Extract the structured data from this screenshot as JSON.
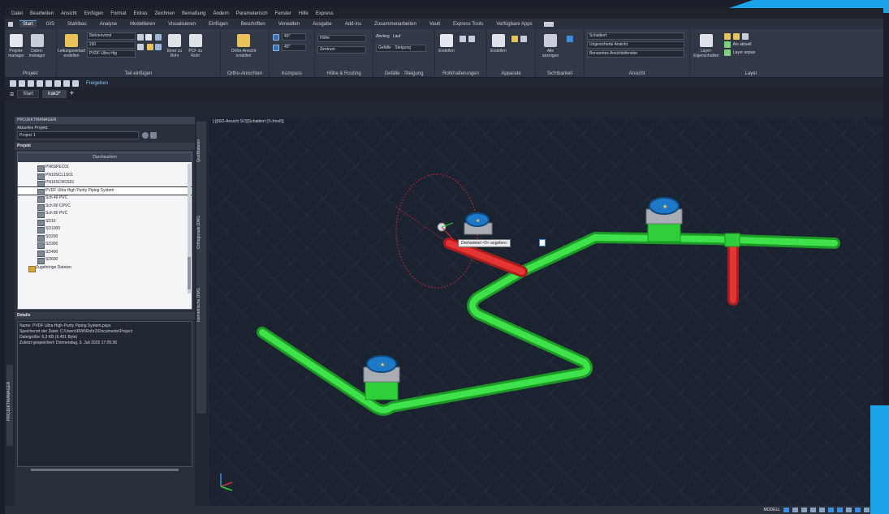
{
  "menu": [
    "Datei",
    "Bearbeiten",
    "Ansicht",
    "Einfügen",
    "Format",
    "Extras",
    "Zeichnen",
    "Bemaßung",
    "Ändern",
    "Parameterisch",
    "Fenster",
    "Hilfe",
    "Express"
  ],
  "ribbon_tabs": [
    {
      "label": "Start",
      "active": true
    },
    {
      "label": "GIS",
      "active": false
    },
    {
      "label": "Stahlbau",
      "active": false
    },
    {
      "label": "Analyse",
      "active": false
    },
    {
      "label": "Modellieren",
      "active": false
    },
    {
      "label": "Visualisieren",
      "active": false
    },
    {
      "label": "Einfügen",
      "active": false
    },
    {
      "label": "Beschriften",
      "active": false
    },
    {
      "label": "Verwalten",
      "active": false
    },
    {
      "label": "Ausgabe",
      "active": false
    },
    {
      "label": "Add-ins",
      "active": false
    },
    {
      "label": "Zusammenarbeiten",
      "active": false
    },
    {
      "label": "Vault",
      "active": false
    },
    {
      "label": "Express Tools",
      "active": false
    },
    {
      "label": "Verfügbare Apps",
      "active": false
    }
  ],
  "ribbon": {
    "projekt": {
      "title": "Projekt",
      "btn1": "Projekt-manager",
      "btn2": "Daten-manager"
    },
    "teil": {
      "title": "Teil einfügen",
      "btn_leitung": "Leitungsverlauf erstellen",
      "combo1": "Stelzenvorst",
      "combo2": "150",
      "combo3": "PVDF Ultra Hig",
      "btn_einer": "Einer zu Rohr",
      "btn_pcf": "PCF zu Rohr"
    },
    "ortho": {
      "title": "Ortho-Ansichten",
      "btn": "Ortho-Ansicht erstellen"
    },
    "kompass": {
      "title": "Kompass",
      "val1": "45°",
      "val2": "45°"
    },
    "hoehe": {
      "title": "Höhe & Routing",
      "lbl": "Höhe",
      "combo": "Zentrum"
    },
    "gefaelle": {
      "title": "Gefälle · Steigung",
      "lbl1": "Abstieg",
      "lbl2": "Lauf",
      "lbl3": "Gefälle · Steigung"
    },
    "rohr": {
      "title": "Rohrhalterungen",
      "btn": "Erstellen"
    },
    "apparate": {
      "title": "Apparate",
      "btn": "Erstellen"
    },
    "sicht": {
      "title": "Sichtbarkeit",
      "btn": "Alle anzeigen"
    },
    "ansicht": {
      "title": "Ansicht",
      "c1": "Schattiert",
      "c2": "Ungesicherte Ansicht",
      "c3": "Benanntes Ansichtsfenster"
    },
    "layer": {
      "title": "Layer",
      "btn": "Layer-Eigenschaften",
      "l1": "Als aktuell",
      "l2": "Layer anpas"
    }
  },
  "qat": {
    "share": "Freigeben"
  },
  "doc_tabs": {
    "start": "Start",
    "active": "trak3*"
  },
  "project_manager": {
    "title": "PROJEKTMANAGER",
    "current_label": "Aktuelles Projekt:",
    "current_value": "Project 1",
    "project_label": "Projekt",
    "search": "Durchsuchen",
    "tree": [
      {
        "label": "PN6SPEC01",
        "sel": false,
        "folder": false
      },
      {
        "label": "PN10SCL1S01",
        "sel": false,
        "folder": false
      },
      {
        "label": "PN16SCM1S01",
        "sel": false,
        "folder": false
      },
      {
        "label": "PVDF Ultra High Purity Piping System",
        "sel": true,
        "folder": false
      },
      {
        "label": "Sch 40 PVC",
        "sel": false,
        "folder": false
      },
      {
        "label": "Sch 80 CPVC",
        "sel": false,
        "folder": false
      },
      {
        "label": "Sch 80 PVC",
        "sel": false,
        "folder": false
      },
      {
        "label": "SD10",
        "sel": false,
        "folder": false
      },
      {
        "label": "SD1000",
        "sel": false,
        "folder": false
      },
      {
        "label": "SD200",
        "sel": false,
        "folder": false
      },
      {
        "label": "SD300",
        "sel": false,
        "folder": false
      },
      {
        "label": "SD400",
        "sel": false,
        "folder": false
      },
      {
        "label": "SD600",
        "sel": false,
        "folder": false
      },
      {
        "label": "Zugehörige Dateien",
        "sel": false,
        "folder": true
      }
    ],
    "details_label": "Details",
    "details": [
      "Name: PVDF Ultra High Purity Piping System.pspx",
      "Speicherort der Datei: C:\\Users\\RWI\\Rohr2\\Documents\\Project",
      "Dateigröße: 6,3 KB (6.451 Byte)",
      "Zuletzt gespeichert: Donnerstag, 3. Juli 2025 17:05:36"
    ]
  },
  "side_tabs": {
    "a": "Quelldateien",
    "b": "Orthogonale DWG",
    "c": "Isometrische DWG",
    "d": "PROJEKTMANAGER"
  },
  "viewport": {
    "label": "[-][ISO-Ansicht SO][Schattiert (Schnell)]",
    "tooltip": "Drehwinkel <0> angeben:",
    "colors": {
      "pipe": "#2fcf3a",
      "pipe_dark": "#1c9a25",
      "red": "#e02a2a",
      "valve": "#1e78c8",
      "bg": "#1c2330"
    }
  },
  "statusbar": {
    "model": "MODELL"
  }
}
